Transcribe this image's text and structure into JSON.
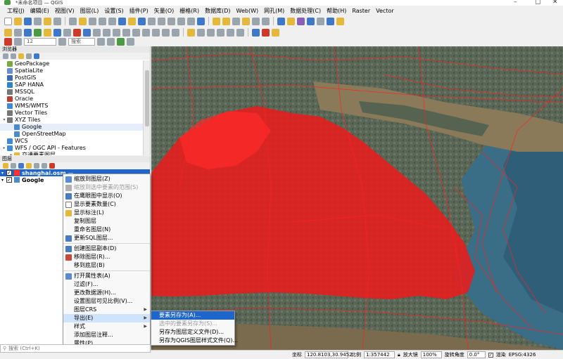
{
  "window": {
    "title": "*未命名项目 — QGIS"
  },
  "menubar": [
    "工程(J)",
    "编辑(E)",
    "视图(V)",
    "图层(L)",
    "设置(S)",
    "插件(P)",
    "矢量(O)",
    "栅格(R)",
    "数据库(D)",
    "Web(W)",
    "网孔(M)",
    "数据处理(C)",
    "帮助(H)",
    "Raster",
    "Vector"
  ],
  "toolbar": {
    "font_size": "12",
    "search_placeholder": "搜索"
  },
  "browser": {
    "title": "浏览器",
    "items": [
      {
        "label": "GeoPackage",
        "icon": "geopackage-icon",
        "color": "#7ba83e",
        "expand": ""
      },
      {
        "label": "SpatiaLite",
        "icon": "spatialite-icon",
        "color": "#6a8fd0",
        "expand": ""
      },
      {
        "label": "PostGIS",
        "icon": "postgis-icon",
        "color": "#3a6ab0",
        "expand": ""
      },
      {
        "label": "SAP HANA",
        "icon": "sap-hana-icon",
        "color": "#2b84c8",
        "expand": ""
      },
      {
        "label": "MSSQL",
        "icon": "mssql-icon",
        "color": "#777777",
        "expand": ""
      },
      {
        "label": "Oracle",
        "icon": "oracle-icon",
        "color": "#b8412f",
        "expand": ""
      },
      {
        "label": "WMS/WMTS",
        "icon": "wms-icon",
        "color": "#3e8ad6",
        "expand": ""
      },
      {
        "label": "Vector Tiles",
        "icon": "vector-tiles-icon",
        "color": "#777777",
        "expand": ""
      },
      {
        "label": "XYZ Tiles",
        "icon": "xyz-tiles-icon",
        "color": "#777777",
        "expand": "▾"
      },
      {
        "label": "Google",
        "icon": "tile-icon",
        "color": "#4c8ac8",
        "expand": "",
        "indent": true,
        "selected": true
      },
      {
        "label": "OpenStreetMap",
        "icon": "tile-icon",
        "color": "#4c8ac8",
        "expand": "",
        "indent": true
      },
      {
        "label": "WCS",
        "icon": "wcs-icon",
        "color": "#3e8ad6",
        "expand": ""
      },
      {
        "label": "WFS / OGC API - Features",
        "icon": "wfs-icon",
        "color": "#3e8ad6",
        "expand": "▸"
      },
      {
        "label": "交通要素图层",
        "icon": "folder-icon",
        "color": "#e4b83a",
        "expand": "▸",
        "indent": true
      }
    ]
  },
  "layers": {
    "title": "图层",
    "items": [
      {
        "label": "shanghai.osm —",
        "checked": true,
        "active": true
      },
      {
        "label": "Google",
        "checked": true,
        "active": false
      }
    ]
  },
  "context_menu": {
    "items": [
      {
        "label": "缩放到图层(Z)",
        "icon": "zoom-layer-icon",
        "color": "#5a8ad0",
        "disabled": false
      },
      {
        "label": "缩放到选中要素的范围(S)",
        "icon": "zoom-selection-icon",
        "color": "#b0b0b0",
        "disabled": true
      },
      {
        "label": "在鹰眼图中显示(O)",
        "icon": "overview-icon",
        "color": "#4a7ac0",
        "disabled": false
      },
      {
        "label": "显示要素数量(C)",
        "icon": "checkbox-icon",
        "color": "#ffffff",
        "disabled": false
      },
      {
        "label": "显示标注(L)",
        "icon": "label-icon",
        "color": "#e4b83a",
        "disabled": false
      },
      {
        "label": "复制图层",
        "icon": "",
        "disabled": false
      },
      {
        "label": "重命名图层(N)",
        "icon": "",
        "disabled": false
      },
      {
        "label": "更新SQL图层...",
        "icon": "sql-icon",
        "color": "#4a7ac0",
        "disabled": false
      },
      {
        "divider": true
      },
      {
        "label": "创建图层副本(D)",
        "icon": "copy-layer-icon",
        "color": "#4a7ac0",
        "disabled": false
      },
      {
        "label": "移除图层(R)...",
        "icon": "remove-layer-icon",
        "color": "#c84a3a",
        "disabled": false
      },
      {
        "label": "移到底层(B)",
        "icon": "",
        "disabled": false
      },
      {
        "divider": true
      },
      {
        "label": "打开属性表(A)",
        "icon": "attribute-table-icon",
        "color": "#5a8ad0",
        "disabled": false
      },
      {
        "label": "过滤(F)...",
        "icon": "",
        "disabled": false
      },
      {
        "label": "更改数据源(H)...",
        "icon": "",
        "disabled": false
      },
      {
        "label": "设置图层可见比例(V)...",
        "icon": "",
        "disabled": false
      },
      {
        "label": "图层CRS",
        "icon": "",
        "disabled": false,
        "submenu": true
      },
      {
        "label": "导出(E)",
        "icon": "",
        "disabled": false,
        "submenu": true,
        "highlight": true
      },
      {
        "label": "样式",
        "icon": "",
        "disabled": false,
        "submenu": true
      },
      {
        "label": "添加图层注释...",
        "icon": "",
        "disabled": false
      },
      {
        "label": "属性(P)...",
        "icon": "",
        "disabled": false
      }
    ]
  },
  "submenu": {
    "items": [
      {
        "label": "要素另存为(A)...",
        "highlight": true,
        "disabled": false
      },
      {
        "label": "选中的要素另存为(S)...",
        "highlight": false,
        "disabled": true
      },
      {
        "label": "另存为图层定义文件(D)...",
        "highlight": false,
        "disabled": false
      },
      {
        "label": "另存为QGIS图层样式文件(Q)...",
        "highlight": false,
        "disabled": false
      }
    ]
  },
  "search": {
    "placeholder": "搜索 (Ctrl+K)"
  },
  "status": {
    "coord_label": "坐标",
    "coord_value": "120.8103,30.9452",
    "scale_label": "比例",
    "scale_value": "1:357442",
    "magnifier_label": "放大镜",
    "magnifier_value": "100%",
    "rotation_label": "旋转角度",
    "rotation_value": "0.0°",
    "render_label": "渲染",
    "crs": "EPSG:4326"
  },
  "colors": {
    "accent": "#1f66cc",
    "osm_lines": "#ff2020",
    "water": "#3a6e86"
  }
}
